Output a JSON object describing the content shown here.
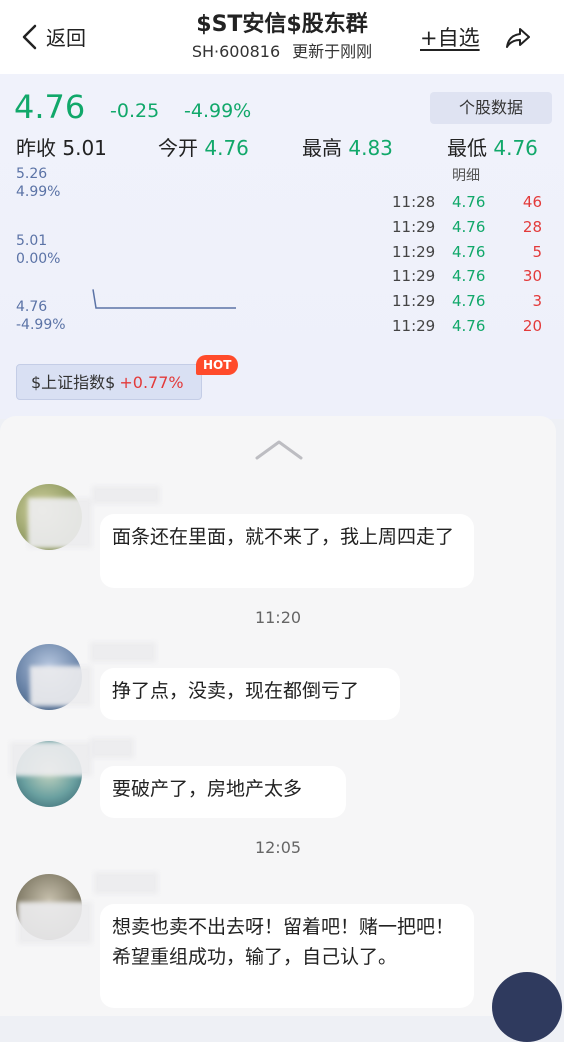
{
  "header": {
    "back_label": "返回",
    "title": "$ST安信$股东群",
    "code": "SH·600816",
    "updated": "更新于刚刚",
    "add_fav": "+自选"
  },
  "quote": {
    "price": "4.76",
    "change": "-0.25",
    "change_pct": "-4.99%",
    "detail_button": "个股数据",
    "prev_close_label": "昨收",
    "prev_close": "5.01",
    "open_label": "今开",
    "open": "4.76",
    "high_label": "最高",
    "high": "4.83",
    "low_label": "最低",
    "low": "4.76",
    "colors": {
      "down": "#11a86a",
      "up": "#e33a3a"
    }
  },
  "chart_data": {
    "type": "line",
    "y_price_ticks": [
      "5.26",
      "5.01",
      "4.76"
    ],
    "y_pct_ticks": [
      "4.99%",
      "0.00%",
      "-4.99%"
    ],
    "series": [
      {
        "values": [
          4.83,
          4.76,
          4.76,
          4.76,
          4.76,
          4.76,
          4.76,
          4.76
        ]
      }
    ],
    "ylim": [
      4.76,
      5.26
    ]
  },
  "trades": {
    "header": "明细",
    "rows": [
      {
        "time": "11:28",
        "price": "4.76",
        "qty": "46"
      },
      {
        "time": "11:29",
        "price": "4.76",
        "qty": "28"
      },
      {
        "time": "11:29",
        "price": "4.76",
        "qty": "5"
      },
      {
        "time": "11:29",
        "price": "4.76",
        "qty": "30"
      },
      {
        "time": "11:29",
        "price": "4.76",
        "qty": "3"
      },
      {
        "time": "11:29",
        "price": "4.76",
        "qty": "20"
      }
    ]
  },
  "index_chip": {
    "name": "$上证指数$",
    "pct": "+0.77%",
    "badge": "HOT"
  },
  "chat": {
    "messages": [
      {
        "text": "面条还在里面，就不来了，我上周四走了"
      },
      {
        "text": "挣了点，没卖，现在都倒亏了"
      },
      {
        "text": "要破产了，房地产太多"
      },
      {
        "text": "想卖也卖不出去呀！留着吧！赌一把吧！希望重组成功，输了，自己认了。"
      }
    ],
    "times": [
      "11:20",
      "12:05"
    ]
  }
}
